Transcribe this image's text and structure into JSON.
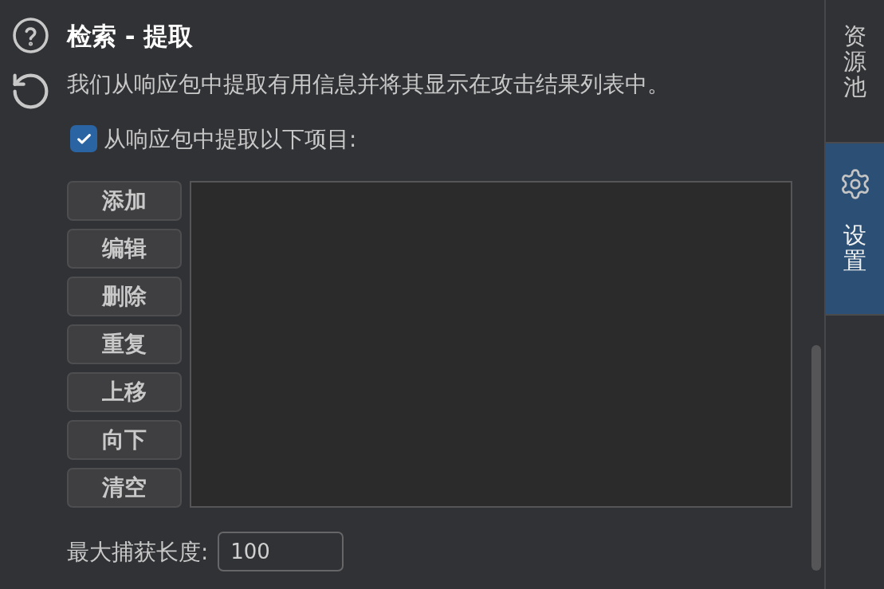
{
  "header": {
    "title": "检索 - 提取",
    "description": "我们从响应包中提取有用信息并将其显示在攻击结果列表中。"
  },
  "extract_option": {
    "label": "从响应包中提取以下项目:",
    "checked": true
  },
  "buttons": [
    "添加",
    "编辑",
    "删除",
    "重复",
    "上移",
    "向下",
    "清空"
  ],
  "max_capture_length": {
    "label": "最大捕获长度:",
    "value": "100"
  },
  "sidebar": {
    "tabs": [
      {
        "label": "资源池",
        "kind": "text",
        "selected": false
      },
      {
        "label": "设置",
        "kind": "icon",
        "selected": true
      }
    ]
  }
}
